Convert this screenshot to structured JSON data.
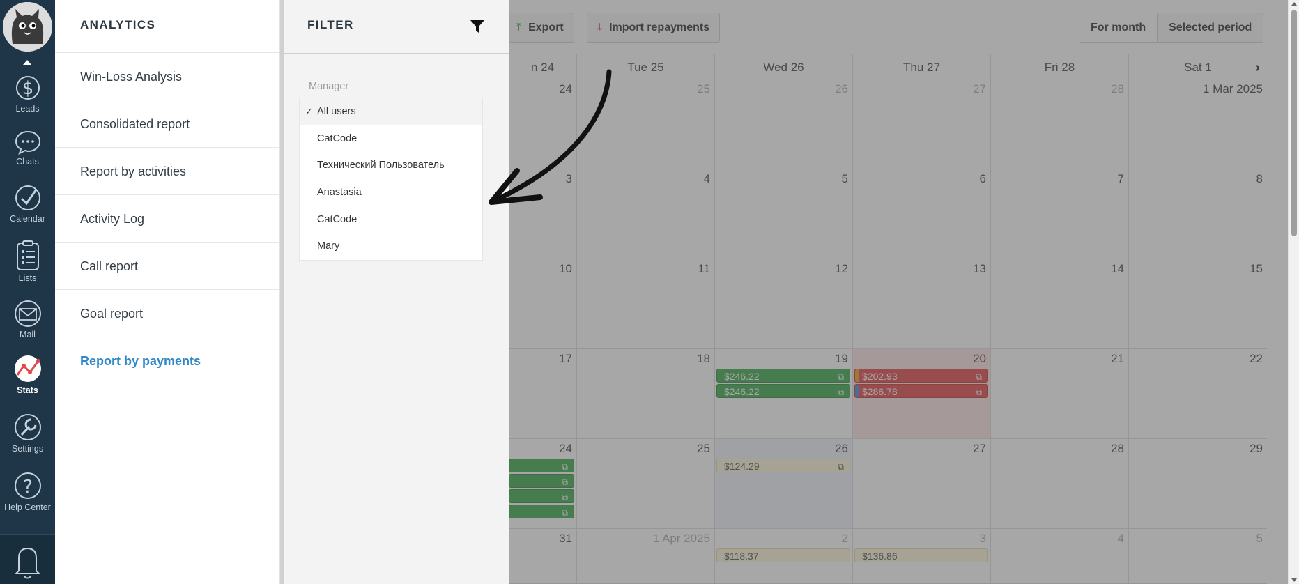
{
  "nav": {
    "items": [
      {
        "label": "Leads",
        "icon": "dollar-icon"
      },
      {
        "label": "Chats",
        "icon": "chat-bubble-icon"
      },
      {
        "label": "Calendar",
        "icon": "checkmark-circle-icon"
      },
      {
        "label": "Lists",
        "icon": "list-clipboard-icon"
      },
      {
        "label": "Mail",
        "icon": "envelope-icon"
      },
      {
        "label": "Stats",
        "icon": "stats-chart-icon"
      },
      {
        "label": "Settings",
        "icon": "wrench-icon"
      },
      {
        "label": "Help Center",
        "icon": "question-circle-icon"
      }
    ],
    "active": "Stats"
  },
  "menu": {
    "title": "ANALYTICS",
    "items": [
      {
        "label": "Win-Loss Analysis"
      },
      {
        "label": "Consolidated report"
      },
      {
        "label": "Report by activities"
      },
      {
        "label": "Activity Log"
      },
      {
        "label": "Call report"
      },
      {
        "label": "Goal report"
      },
      {
        "label": "Report by payments"
      }
    ],
    "active": "Report by payments"
  },
  "filter": {
    "title": "FILTER",
    "manager_label": "Manager",
    "options": [
      "All users",
      "CatCode",
      "Технический Пользователь",
      "Anastasia",
      "CatCode",
      "Mary"
    ],
    "selected": "All users",
    "check": "✓"
  },
  "toolbar": {
    "export_label": "Export",
    "import_label": "Import repayments",
    "for_month_label": "For month",
    "selected_period_label": "Selected period"
  },
  "calendar": {
    "headers": [
      "n 24",
      "Tue 25",
      "Wed 26",
      "Thu 27",
      "Fri 28",
      "Sat 1"
    ],
    "next": "›",
    "rows": [
      [
        "24",
        "25",
        "26",
        "27",
        "28",
        "1 Mar 2025"
      ],
      [
        "3",
        "4",
        "5",
        "6",
        "7",
        "8"
      ],
      [
        "10",
        "11",
        "12",
        "13",
        "14",
        "15"
      ],
      [
        "17",
        "18",
        "19",
        "20",
        "21",
        "22"
      ],
      [
        "24",
        "25",
        "26",
        "27",
        "28",
        "29"
      ],
      [
        "31",
        "1 Apr 2025",
        "2",
        "3",
        "4",
        "5"
      ]
    ],
    "payments": {
      "wed19_a": "$246.22",
      "wed19_b": "$246.22",
      "thu20_a": "$202.93",
      "thu20_b": "$286.78",
      "wed26": "$124.29",
      "wed2": "$118.37",
      "thu3": "$136.86"
    },
    "colors": {
      "green": "#3fa94c",
      "red": "#e0484b",
      "yellow": "#fff7d8",
      "accent": "#2e87c8"
    }
  }
}
